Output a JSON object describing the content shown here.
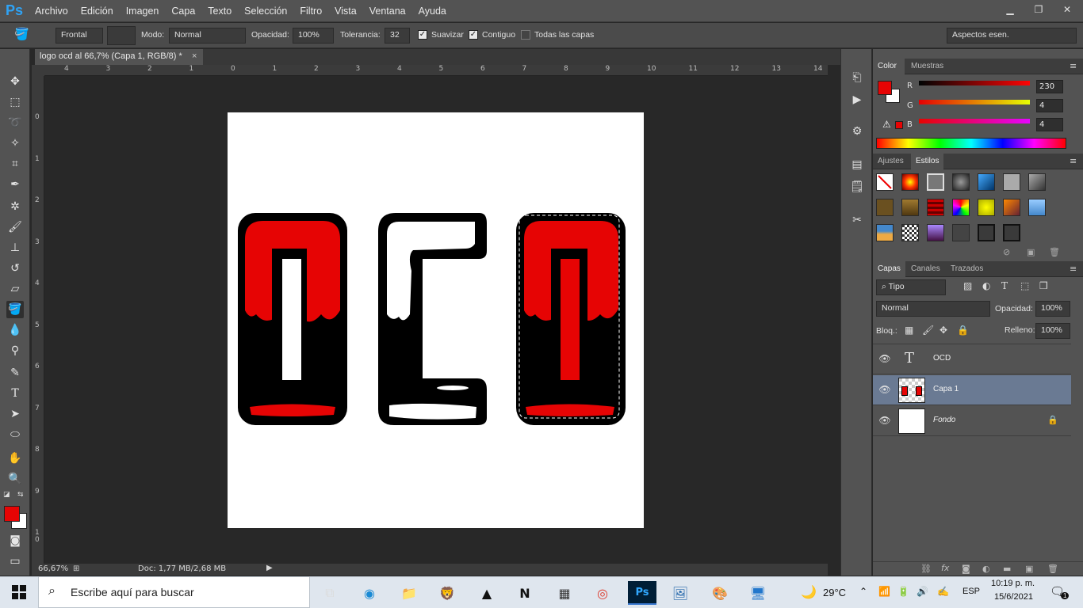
{
  "menubar": {
    "logo": "Ps",
    "items": [
      "Archivo",
      "Edición",
      "Imagen",
      "Capa",
      "Texto",
      "Selección",
      "Filtro",
      "Vista",
      "Ventana",
      "Ayuda"
    ]
  },
  "options": {
    "source": "Frontal",
    "mode_label": "Modo:",
    "mode_value": "Normal",
    "opacity_label": "Opacidad:",
    "opacity_value": "100%",
    "tolerance_label": "Tolerancia:",
    "tolerance_value": "32",
    "antialias_label": "Suavizar",
    "antialias_checked": true,
    "contiguous_label": "Contiguo",
    "contiguous_checked": true,
    "all_layers_label": "Todas las capas",
    "all_layers_checked": false,
    "workspace": "Aspectos esen."
  },
  "document": {
    "tab_title": "logo ocd al 66,7% (Capa 1, RGB/8) *",
    "zoom": "66,67%",
    "doc_info": "Doc: 1,77 MB/2,68 MB"
  },
  "rulers": {
    "h": [
      "4",
      "3",
      "2",
      "1",
      "0",
      "1",
      "2",
      "3",
      "4",
      "5",
      "6",
      "7",
      "8",
      "9",
      "10",
      "11",
      "12",
      "13",
      "14"
    ],
    "v": [
      "0",
      "1",
      "2",
      "3",
      "4",
      "5",
      "6",
      "7",
      "8",
      "9",
      "1 0"
    ]
  },
  "color_panel": {
    "tabs": [
      "Color",
      "Muestras"
    ],
    "r_label": "R",
    "r_value": "230",
    "g_label": "G",
    "g_value": "4",
    "b_label": "B",
    "b_value": "4",
    "foreground": "#e60404",
    "background": "#ffffff"
  },
  "styles_panel": {
    "tabs": [
      "Ajustes",
      "Estilos"
    ]
  },
  "layers_panel": {
    "tabs": [
      "Capas",
      "Canales",
      "Trazados"
    ],
    "filter": "Tipo",
    "blend_mode": "Normal",
    "opacity_label": "Opacidad:",
    "opacity_value": "100%",
    "lock_label": "Bloq.:",
    "fill_label": "Relleno:",
    "fill_value": "100%",
    "layers": [
      {
        "name": "OCD",
        "type": "text"
      },
      {
        "name": "Capa 1",
        "type": "pixel",
        "selected": true
      },
      {
        "name": "Fondo",
        "type": "background",
        "locked": true
      }
    ]
  },
  "taskbar": {
    "search_placeholder": "Escribe aquí para buscar",
    "weather": "29°C",
    "language": "ESP",
    "time": "10:19 p. m.",
    "date": "15/6/2021",
    "notifications": "1"
  }
}
